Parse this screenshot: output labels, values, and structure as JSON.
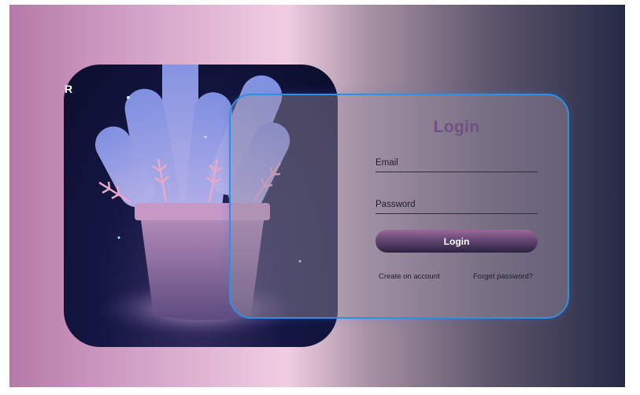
{
  "brand": {
    "letter": "R"
  },
  "login": {
    "title": "Login",
    "email_label": "Email",
    "password_label": "Password",
    "submit_label": "Login",
    "create_account_link": "Create on account",
    "forgot_password_link": "Forget password?"
  },
  "colors": {
    "card_border": "#2f8fe0",
    "button_top": "#9b6a97",
    "button_bottom": "#2a2240",
    "title": "#6e4f86"
  },
  "illustration": {
    "subject": "potted-cactus-illustration"
  }
}
